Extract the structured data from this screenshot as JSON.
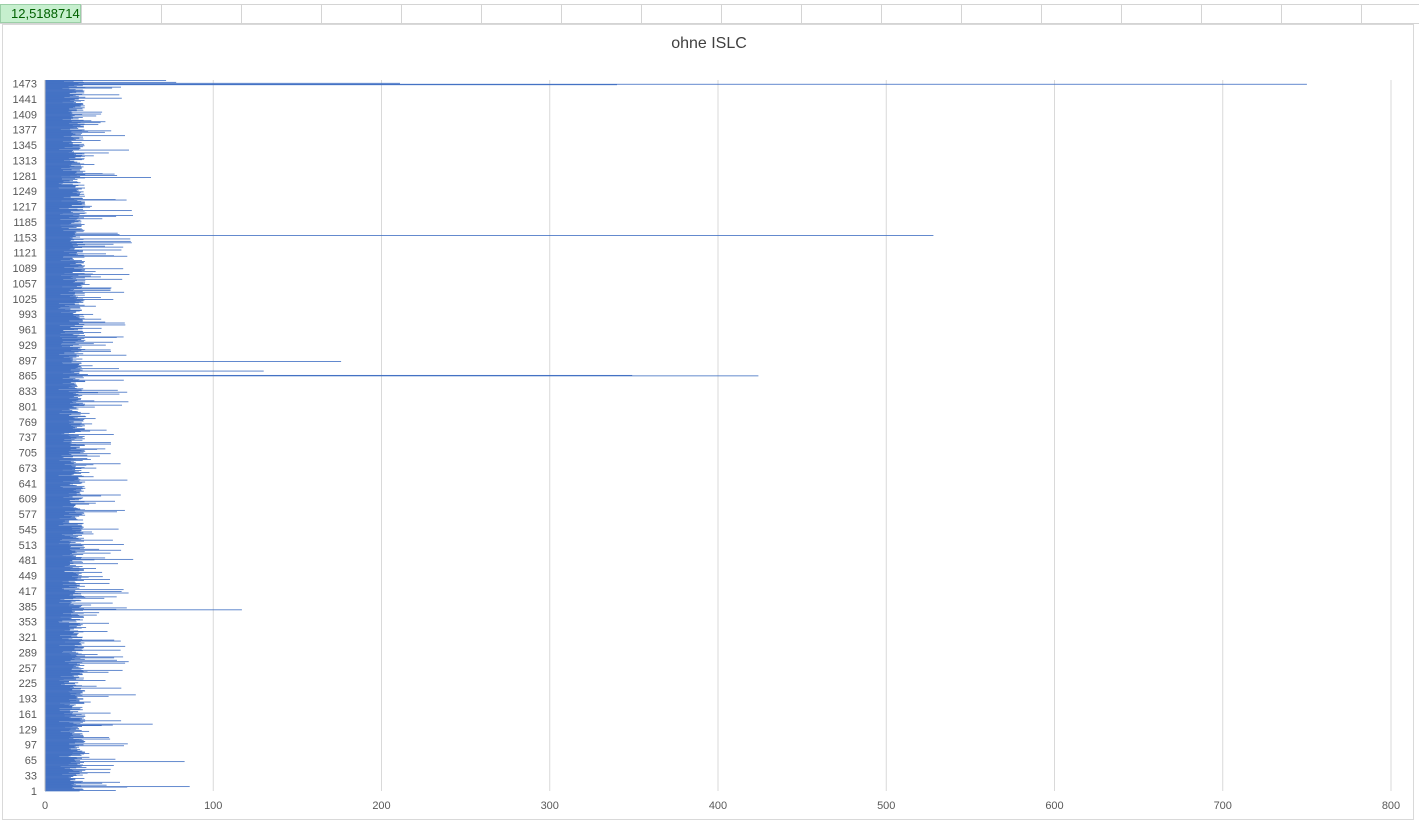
{
  "sheet": {
    "selected_cell_value": "12,5188714"
  },
  "colors": {
    "bar": "#4472c4",
    "gridline": "#d9d9d9",
    "axis_text": "#595959",
    "title": "#404040",
    "cell_fill": "#c6efce",
    "cell_text": "#006100"
  },
  "chart_data": {
    "type": "bar",
    "orientation": "horizontal",
    "title": "ohne ISLC",
    "xlabel": "",
    "ylabel": "",
    "xlim": [
      0,
      800
    ],
    "x_ticks": [
      "0",
      "100",
      "200",
      "300",
      "400",
      "500",
      "600",
      "700",
      "800"
    ],
    "category_count": 1480,
    "category_tick_labels": [
      "1",
      "33",
      "65",
      "97",
      "129",
      "161",
      "193",
      "225",
      "257",
      "289",
      "321",
      "353",
      "385",
      "417",
      "449",
      "481",
      "513",
      "545",
      "577",
      "609",
      "641",
      "673",
      "705",
      "737",
      "769",
      "801",
      "833",
      "865",
      "897",
      "929",
      "961",
      "993",
      "1025",
      "1057",
      "1089",
      "1121",
      "1153",
      "1185",
      "1217",
      "1249",
      "1281",
      "1313",
      "1345",
      "1377",
      "1409",
      "1441",
      "1473"
    ],
    "grid": "vertical",
    "legend": "none",
    "typical_value_range": [
      8,
      40
    ],
    "notable_values": [
      {
        "category": 10,
        "value": 86
      },
      {
        "category": 62,
        "value": 83
      },
      {
        "category": 140,
        "value": 64
      },
      {
        "category": 378,
        "value": 117
      },
      {
        "category": 865,
        "value": 424
      },
      {
        "category": 866,
        "value": 349
      },
      {
        "category": 875,
        "value": 130
      },
      {
        "category": 895,
        "value": 176
      },
      {
        "category": 1157,
        "value": 528
      },
      {
        "category": 1278,
        "value": 63
      },
      {
        "category": 1472,
        "value": 750
      },
      {
        "category": 1471,
        "value": 340
      },
      {
        "category": 1474,
        "value": 211
      },
      {
        "category": 1476,
        "value": 78
      },
      {
        "category": 1480,
        "value": 72
      }
    ]
  }
}
